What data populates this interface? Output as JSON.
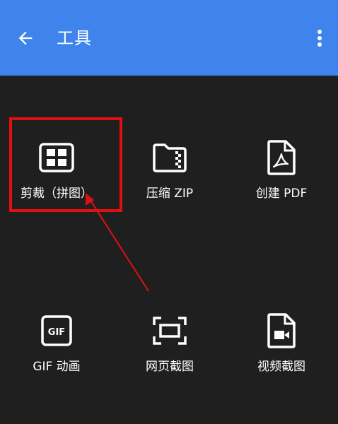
{
  "appbar": {
    "title": "工具",
    "back_icon": "arrow-left-icon",
    "more_icon": "more-vertical-icon",
    "color": "#3f84ec"
  },
  "tools": [
    {
      "label": "剪裁（拼图）",
      "icon": "grid-icon"
    },
    {
      "label": "压缩 ZIP",
      "icon": "zip-folder-icon"
    },
    {
      "label": "创建 PDF",
      "icon": "pdf-file-icon"
    },
    {
      "label": "GIF 动画",
      "icon": "gif-icon"
    },
    {
      "label": "网页截图",
      "icon": "screenshot-frame-icon"
    },
    {
      "label": "视频截图",
      "icon": "video-file-icon"
    }
  ],
  "annotation": {
    "highlight_color": "#e01010"
  },
  "background_color": "#1f1f1f"
}
